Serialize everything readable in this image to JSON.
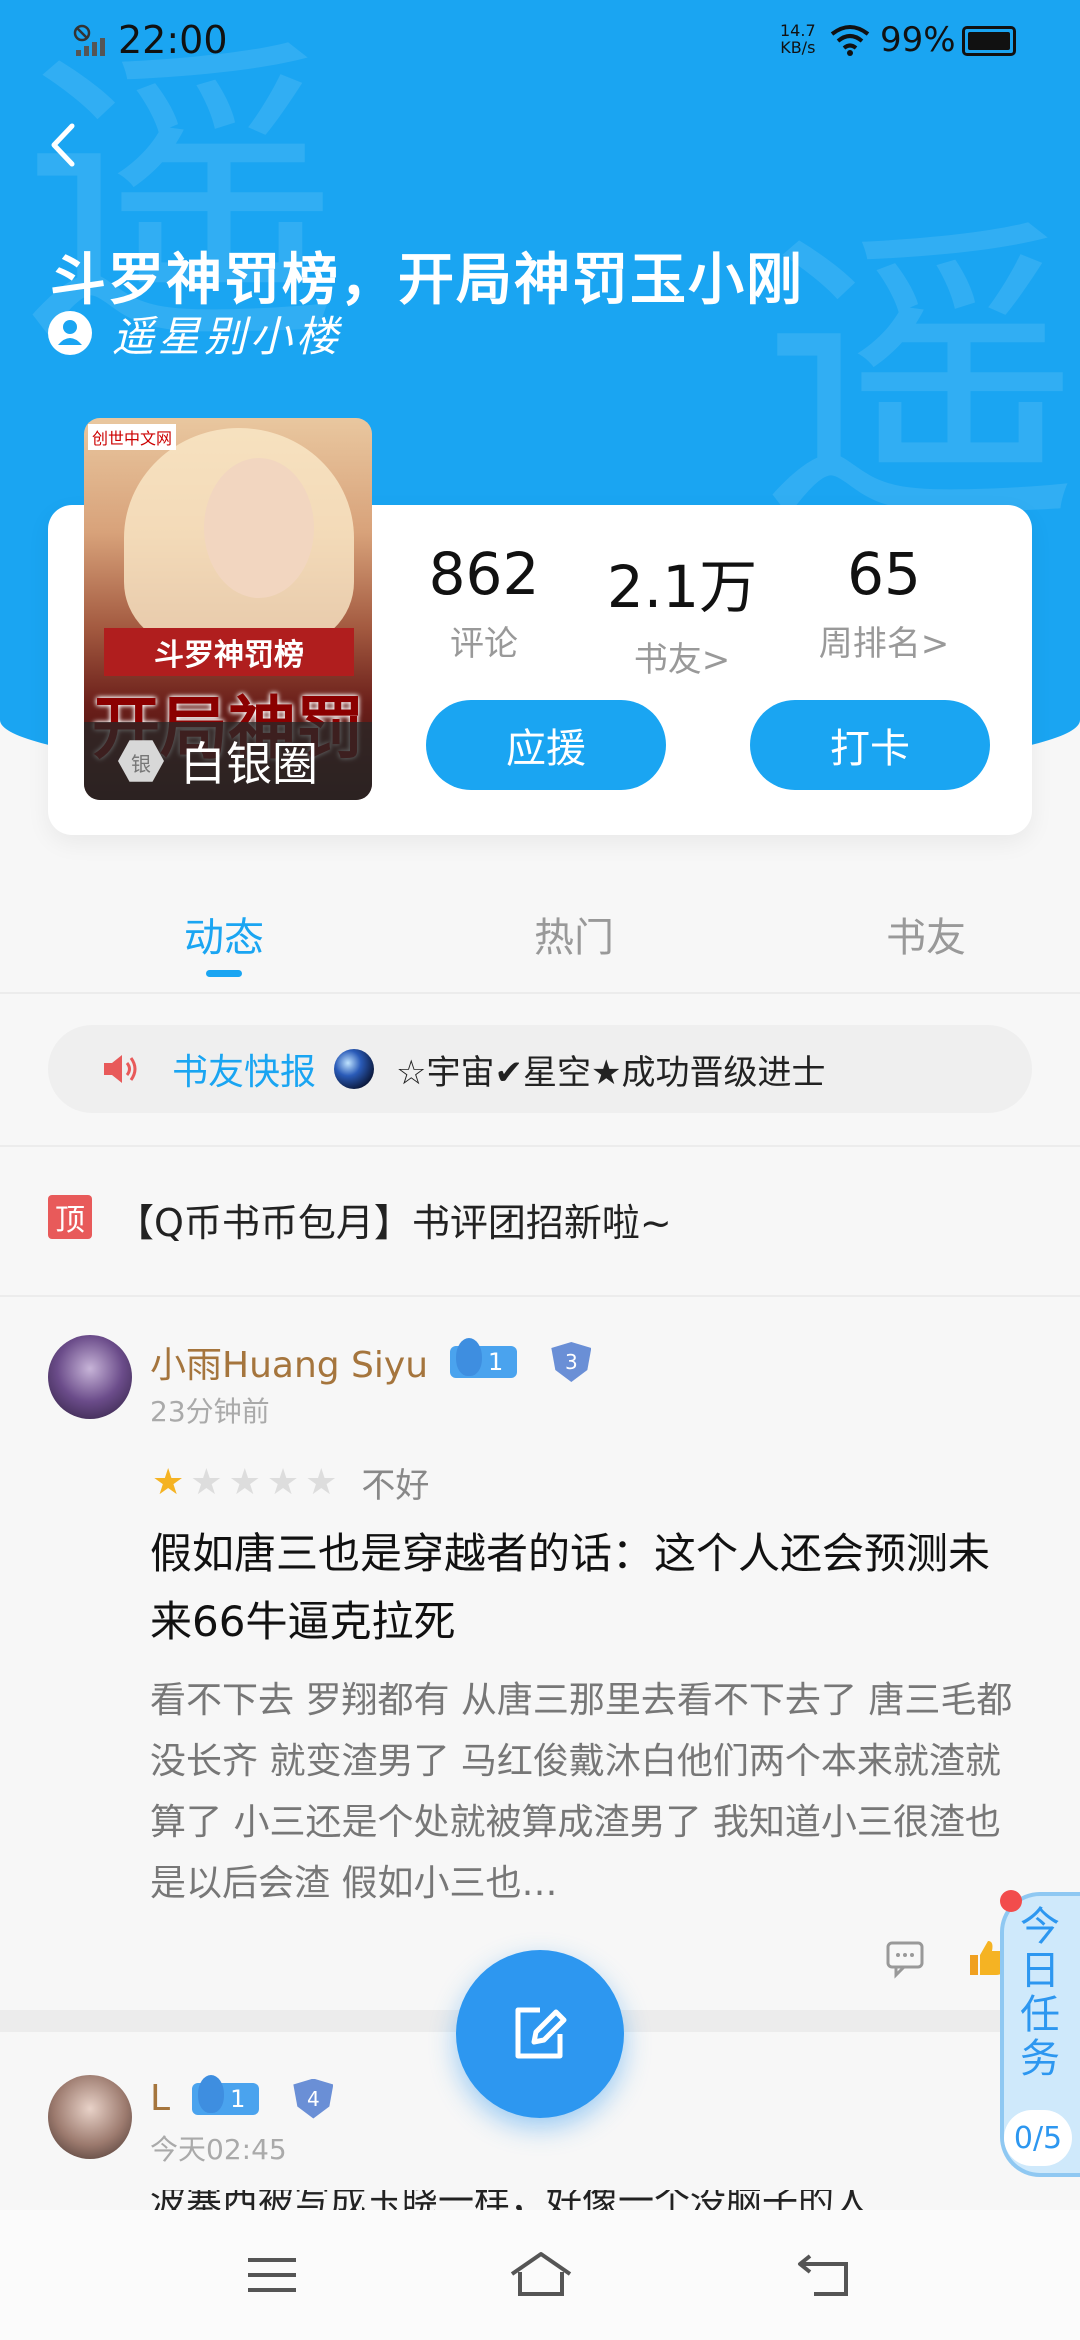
{
  "status_bar": {
    "time": "22:00",
    "net_speed_value": "14.7",
    "net_speed_unit": "KB/s",
    "battery": "99%"
  },
  "header": {
    "watermark_char": "遥",
    "book_title": "斗罗神罚榜，开局神罚玉小刚",
    "author": "遥星别小楼"
  },
  "cover": {
    "publisher_tag": "创世中文网",
    "title_line1": "斗罗神罚榜",
    "title_line2": "开局神罚",
    "circle_badge_icon": "银",
    "circle_badge_label": "白银圈"
  },
  "stats": [
    {
      "value": "862",
      "label": "评论"
    },
    {
      "value": "2.1万",
      "label": "书友>"
    },
    {
      "value": "65",
      "label": "周排名>"
    }
  ],
  "actions": {
    "support": "应援",
    "checkin": "打卡"
  },
  "tabs": [
    {
      "label": "动态",
      "active": true
    },
    {
      "label": "热门",
      "active": false
    },
    {
      "label": "书友",
      "active": false
    }
  ],
  "news": {
    "label": "书友快报",
    "message": "☆宇宙✔星空★成功晋级进士"
  },
  "pinned": {
    "tag": "顶",
    "text": "【Q币书币包月】书评团招新啦~"
  },
  "posts": [
    {
      "username": "小雨Huang Siyu",
      "fan_level": "1",
      "rank_badge": "3",
      "time": "23分钟前",
      "rating_stars": 1,
      "rating_max": 5,
      "rating_word": "不好",
      "title": "假如唐三也是穿越者的话：这个人还会预测未来66牛逼克拉死",
      "body": "看不下去 罗翔都有 从唐三那里去看不下去了 唐三毛都没长齐 就变渣男了 马红俊戴沐白他们两个本来就渣就算了 小三还是个处就被算成渣男了 我知道小三很渣也是以后会渣 假如小三也…"
    },
    {
      "username": "L",
      "fan_level": "1",
      "rank_badge": "4",
      "time": "今天02:45",
      "body_partial": "波塞西被写成玉晓一样，好像一个没脑子的人"
    }
  ],
  "daily_task": {
    "label": "今日任务",
    "progress": "0/5"
  },
  "colors": {
    "accent": "#1aa5f2",
    "username": "#a5753d",
    "pin": "#e85a5a",
    "star": "#f5b323"
  },
  "icons": [
    "back-icon",
    "user-icon",
    "speaker-icon",
    "comment-icon",
    "like-icon",
    "edit-icon",
    "menu-icon",
    "home-icon",
    "return-icon"
  ]
}
